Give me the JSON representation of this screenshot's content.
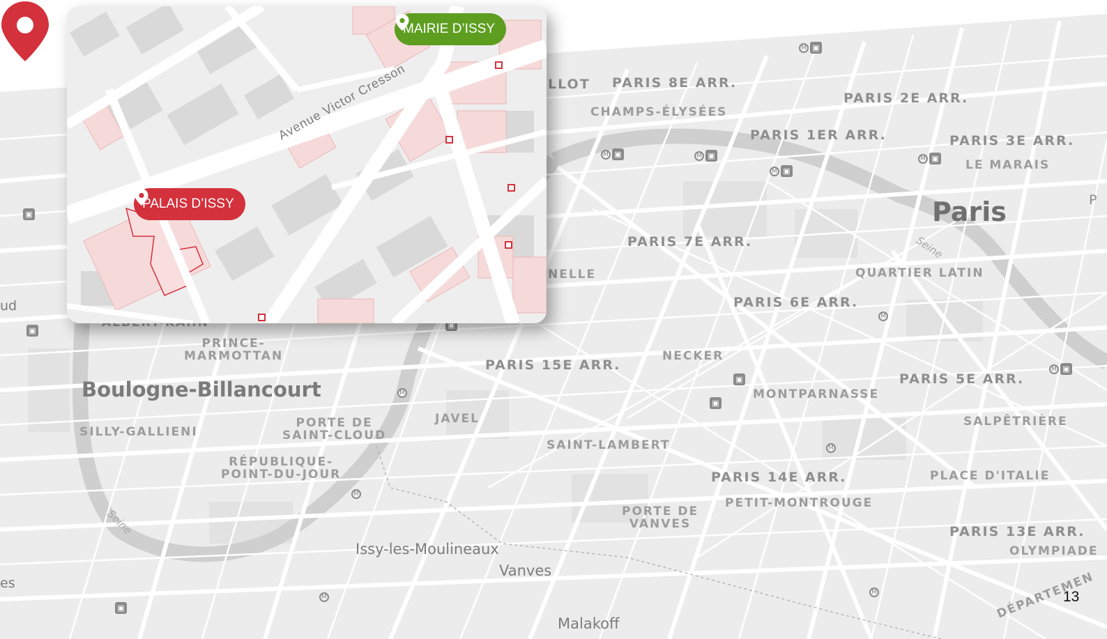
{
  "map": {
    "colors": {
      "land": "#ececec",
      "roads": "#ffffff",
      "water": "#cfcfcf",
      "labels": "#8e8e8e",
      "main_pin": "#d3313c",
      "mairie_callout": "#5d9e20",
      "palais_callout": "#d3313c",
      "inset_building_highlight": "#f5d3d3"
    },
    "labels": {
      "champs_elysees": "CHAMPS-ÉLYSÉES",
      "paris_8": "PARIS 8E ARR.",
      "paris_2": "PARIS 2E ARR.",
      "paris_1": "PARIS 1ER ARR.",
      "paris_3": "PARIS 3E ARR.",
      "le_marais": "LE MARAIS",
      "paris": "Paris",
      "seine_1": "Seine",
      "quartier_latin": "QUARTIER LATIN",
      "paris_7": "PARIS 7E ARR.",
      "paris_6": "PARIS 6E ARR.",
      "prince_marmottan": "PRINCE-\nMARMOTTAN",
      "boulogne": "Boulogne-Billancourt",
      "paris_15": "PARIS 15E ARR.",
      "necker": "NECKER",
      "montparnasse": "MONTPARNASSE",
      "paris_5": "PARIS 5E ARR.",
      "silly_gallieni": "SILLY-GALLIENI",
      "porte_saint_cloud": "PORTE DE\nSAINT-CLOUD",
      "javel": "JAVEL",
      "salpetriere": "SALPÊTRIÈRE",
      "saint_lambert": "SAINT-LAMBERT",
      "republique_point_du_jour": "RÉPUBLIQUE-\nPOINT-DU-JOUR",
      "paris_14": "PARIS 14E ARR.",
      "place_italie": "PLACE D'ITALIE",
      "petit_montrouge": "PETIT-MONTROUGE",
      "porte_vanves": "PORTE DE\nVANVES",
      "paris_13": "PARIS 13E ARR.",
      "olympiades": "OLYMPIADE",
      "issy": "Issy-les-Moulineaux",
      "vanves": "Vanves",
      "seine_2": "Seine",
      "malakoff": "Malakoff",
      "departement": "DÉPARTEMEN",
      "llot": "LLOT",
      "nelle": "NELLE",
      "es": "es",
      "ud": "ud",
      "p_edge": "P",
      "albert_kahn": "ALBERT-KAHN"
    },
    "icons": {
      "train": "train-station-icon",
      "metro": "metro-icon",
      "pin": "location-pin-icon"
    }
  },
  "inset": {
    "street_name": "Avenue Victor Cresson",
    "callouts": {
      "mairie": "MAIRIE D’ISSY",
      "palais": "PALAIS D’ISSY"
    }
  },
  "page_number": "13"
}
